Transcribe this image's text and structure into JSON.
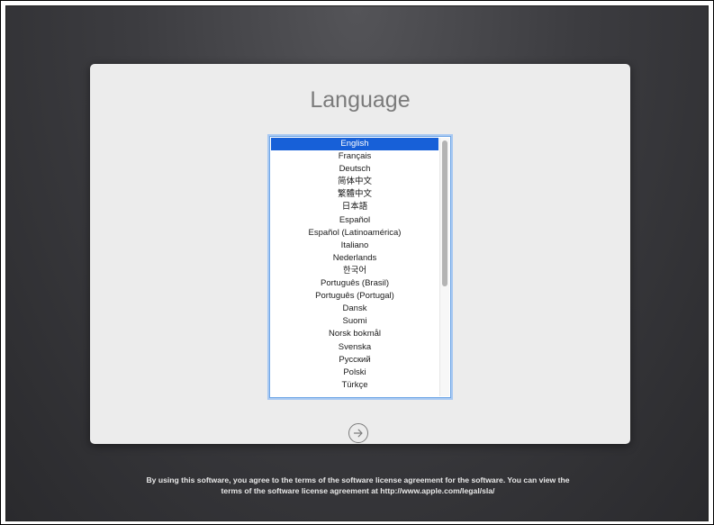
{
  "installer": {
    "title": "Language",
    "languages": [
      "English",
      "Français",
      "Deutsch",
      "简体中文",
      "繁體中文",
      "日本語",
      "Español",
      "Español (Latinoamérica)",
      "Italiano",
      "Nederlands",
      "한국어",
      "Português (Brasil)",
      "Português (Portugal)",
      "Dansk",
      "Suomi",
      "Norsk bokmål",
      "Svenska",
      "Русский",
      "Polski",
      "Türkçe"
    ],
    "selected_language": "English",
    "next_button_icon": "arrow-right-circle-icon",
    "license_line1": "By using this software, you agree to the terms of the software license agreement for the software. You can view the",
    "license_line2": "terms of the software license agreement at http://www.apple.com/legal/sla/"
  },
  "colors": {
    "selection": "#1760d8",
    "panel": "#ececec",
    "background": "#3c3c40",
    "title": "#7b7b7b"
  }
}
